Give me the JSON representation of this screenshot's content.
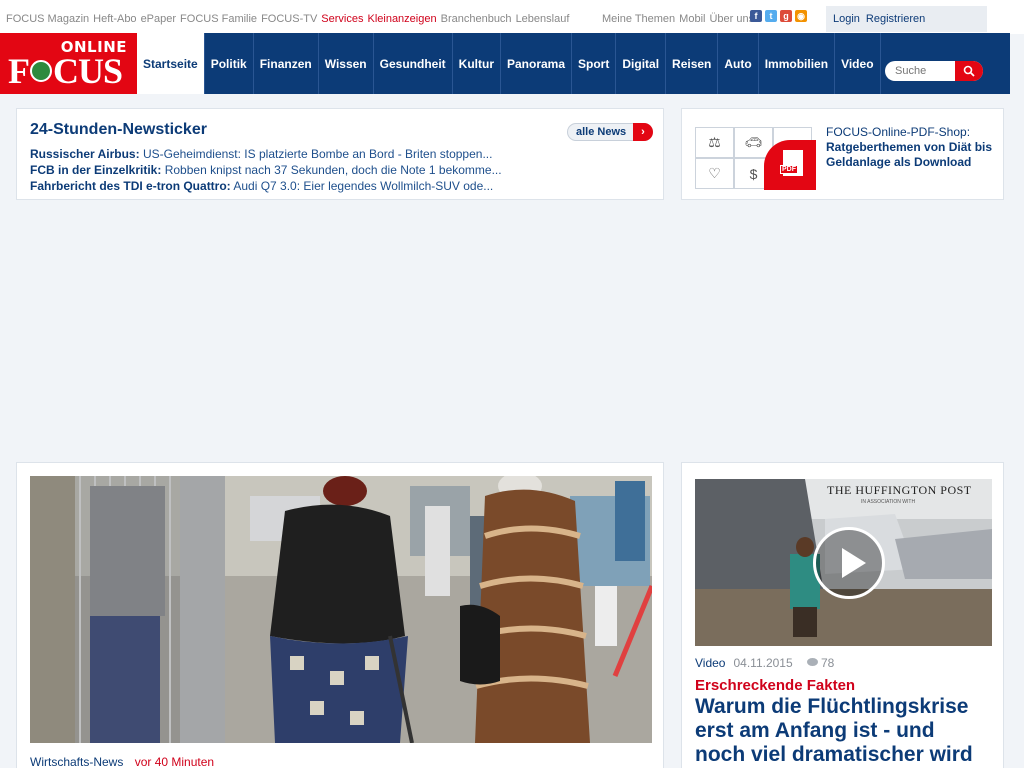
{
  "topbar": {
    "links": [
      {
        "label": "FOCUS Magazin",
        "highlight": false
      },
      {
        "label": "Heft-Abo",
        "highlight": false
      },
      {
        "label": "ePaper",
        "highlight": false
      },
      {
        "label": "FOCUS Familie",
        "highlight": false
      },
      {
        "label": "FOCUS-TV",
        "highlight": false
      },
      {
        "label": "Services",
        "highlight": true
      },
      {
        "label": "Kleinanzeigen",
        "highlight": true
      },
      {
        "label": "Branchenbuch",
        "highlight": false
      },
      {
        "label": "Lebenslauf",
        "highlight": false
      }
    ],
    "right_links": [
      "Meine Themen",
      "Mobil",
      "Über uns"
    ],
    "social_icons": [
      "facebook-icon",
      "twitter-icon",
      "googleplus-icon",
      "rss-icon"
    ],
    "login": "Login",
    "register": "Registrieren"
  },
  "logo": {
    "online": "ONLINE",
    "focus": "FOCUS"
  },
  "nav": {
    "items": [
      {
        "label": "Startseite",
        "active": true
      },
      {
        "label": "Politik",
        "active": false
      },
      {
        "label": "Finanzen",
        "active": false
      },
      {
        "label": "Wissen",
        "active": false
      },
      {
        "label": "Gesundheit",
        "active": false
      },
      {
        "label": "Kultur",
        "active": false
      },
      {
        "label": "Panorama",
        "active": false
      },
      {
        "label": "Sport",
        "active": false
      },
      {
        "label": "Digital",
        "active": false
      },
      {
        "label": "Reisen",
        "active": false
      },
      {
        "label": "Auto",
        "active": false
      },
      {
        "label": "Immobilien",
        "active": false
      },
      {
        "label": "Video",
        "active": false
      }
    ],
    "search_placeholder": "Suche"
  },
  "newsticker": {
    "title": "24-Stunden-Newsticker",
    "all_news": "alle News",
    "items": [
      {
        "kicker": "Russischer Airbus:",
        "text": "US-Geheimdienst: IS platzierte Bombe an Bord - Briten stoppen..."
      },
      {
        "kicker": "FCB in der Einzelkritik:",
        "text": "Robben knipst nach 37 Sekunden, doch die Note 1 bekomme..."
      },
      {
        "kicker": "Fahrbericht des TDI e-tron Quattro:",
        "text": "Audi Q7 3.0: Eier legendes Wollmilch-SUV ode..."
      }
    ]
  },
  "pdfshop": {
    "kicker": "FOCUS-Online-PDF-Shop:",
    "title": "Ratgeberthemen von Diät bis Geldanlage als Download",
    "badge": "PDF",
    "icons": [
      "scales-icon",
      "car-icon",
      "palm-tree-icon",
      "heart-rate-icon",
      "dollar-jar-icon",
      "pdf-icon"
    ]
  },
  "main_teaser": {
    "category": "Wirtschafts-News",
    "time": "vor 40 Minuten"
  },
  "side_teaser": {
    "brand": "THE HUFFINGTON POST",
    "brand_sub": "IN ASSOCIATION WITH",
    "category": "Video",
    "date": "04.11.2015",
    "comments": "78",
    "kicker": "Erschreckende Fakten",
    "headline": "Warum die Flüchtlingskrise erst am Anfang ist - und noch viel dramatischer wird"
  },
  "colors": {
    "brand_red": "#e30613",
    "nav_blue": "#0c3b77",
    "background": "#f1f4f8"
  }
}
